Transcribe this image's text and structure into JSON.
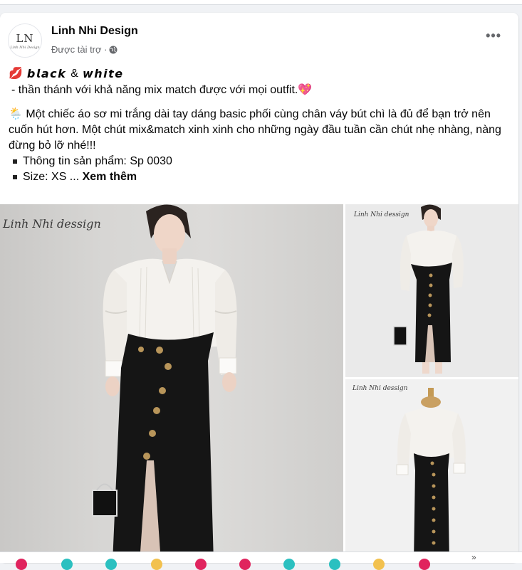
{
  "post": {
    "page_name": "Linh Nhi Design",
    "sponsored_label": "Được tài trợ ·",
    "avatar": {
      "monogram": "LN",
      "script": "Linh Nhi Design"
    },
    "more_label": "•••"
  },
  "content": {
    "line1_emoji": "💋",
    "line1_word1": "𝙗𝙡𝙖𝙘𝙠",
    "line1_amp": "&",
    "line1_word2": "𝙬𝙝𝙞𝙩𝙚",
    "line2": "-  thần thánh với khả năng mix match được với mọi outfit.",
    "line2_emoji": "💖",
    "para_emoji": "🌦️",
    "para": "Một chiếc áo sơ mi trắng dài tay dáng basic phối cùng chân váy bút chì là đủ để bạn trở nên cuốn hút hơn. Một chút mix&match xinh xinh cho những ngày đầu tuần cần chút nhẹ nhàng, nàng đừng bỏ lỡ nhé!!!",
    "bullet1": "Thông tin sản phẩm: Sp 0030",
    "bullet2": "Size: XS ...",
    "see_more": "Xem thêm"
  },
  "gallery": {
    "watermark": "Linh Nhi dessign",
    "watermark_small_1": "Linh Nhi dessign",
    "watermark_small_2": "Linh Nhi dessign"
  },
  "colors": {
    "blouse": "#f4f2ee",
    "skirt": "#151515",
    "button": "#b8955a"
  }
}
